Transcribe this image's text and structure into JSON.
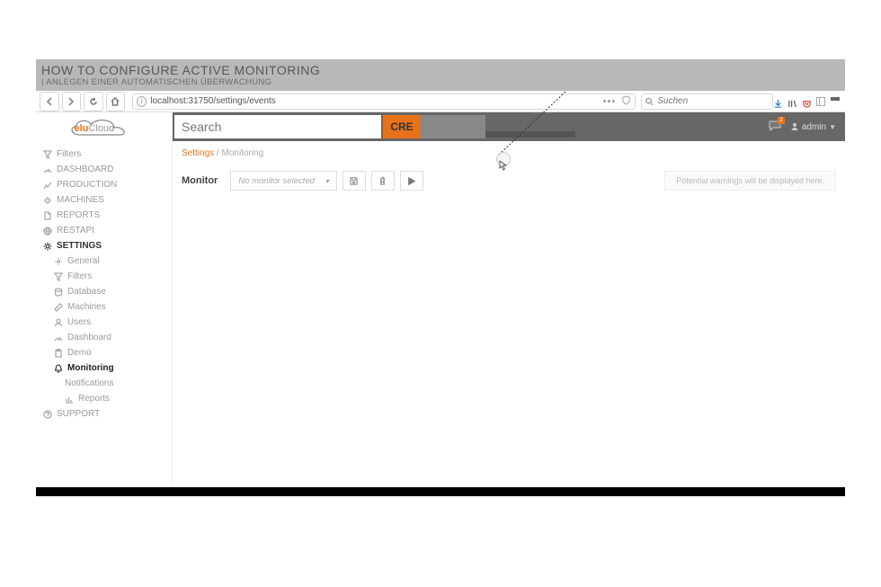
{
  "banner": {
    "title": "HOW TO CONFIGURE ACTIVE MONITORING",
    "subtitle": "| ANLEGEN EINER AUTOMATISCHEN ÜBERWACHUNG"
  },
  "browser": {
    "url": "localhost:31750/settings/events",
    "search_placeholder": "Suchen"
  },
  "logo": {
    "prefix": "elu",
    "suffix": "Cloud"
  },
  "sidebar": {
    "items": [
      {
        "label": "Filters"
      },
      {
        "label": "DASHBOARD"
      },
      {
        "label": "PRODUCTION"
      },
      {
        "label": "MACHINES"
      },
      {
        "label": "REPORTS"
      },
      {
        "label": "RESTAPI"
      },
      {
        "label": "SETTINGS"
      }
    ],
    "settings_children": [
      {
        "label": "General"
      },
      {
        "label": "Filters"
      },
      {
        "label": "Database"
      },
      {
        "label": "Machines"
      },
      {
        "label": "Users"
      },
      {
        "label": "Dashboard"
      },
      {
        "label": "Demo"
      },
      {
        "label": "Monitoring"
      }
    ],
    "monitoring_children": [
      {
        "label": "Notifications"
      },
      {
        "label": "Reports"
      }
    ],
    "support": {
      "label": "SUPPORT"
    }
  },
  "topbar": {
    "search_placeholder": "Search",
    "badge": "CRE",
    "notif_count": "2",
    "user": "admin"
  },
  "crumbs": {
    "a": "Settings",
    "sep": "/",
    "b": "Monitoring"
  },
  "monitor": {
    "label": "Monitor",
    "dropdown": "No monitor selected"
  },
  "warn": "Potential warnings will be displayed here."
}
